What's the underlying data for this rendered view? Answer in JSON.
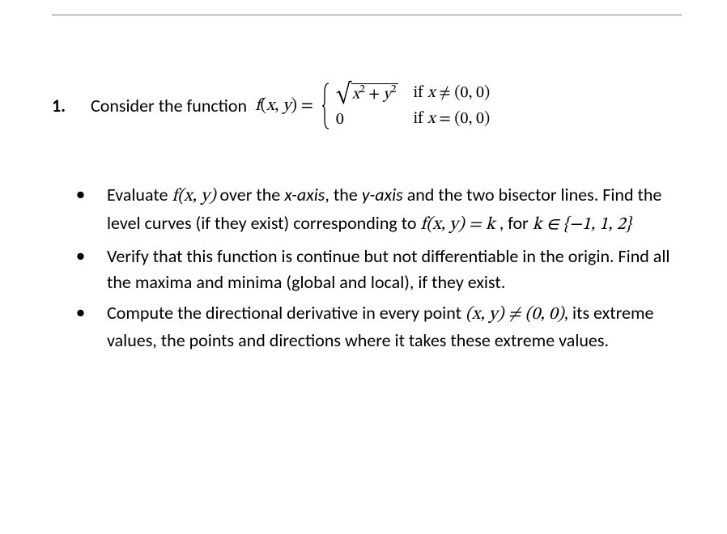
{
  "problem": {
    "number": "1.",
    "stem_text": "Consider the function",
    "func_name_html": "f(x, y) =",
    "piecewise": {
      "case1": {
        "sqrt_arg_plain": "x² + y²",
        "cond_prefix": "if ",
        "cond_math": "x ≠ (0, 0)"
      },
      "case2": {
        "value": "0",
        "cond_prefix": "if ",
        "cond_math": "x = (0, 0)"
      }
    }
  },
  "bullets": [
    {
      "parts": [
        {
          "t": "Evaluate ",
          "cls": ""
        },
        {
          "t": "f(x, y)",
          "cls": "math-serif"
        },
        {
          "t": " over the ",
          "cls": ""
        },
        {
          "t": "x-axis",
          "cls": "italic"
        },
        {
          "t": ", the ",
          "cls": ""
        },
        {
          "t": "y-axis",
          "cls": "italic"
        },
        {
          "t": " and the two bisector lines. Find the level curves (if they exist) corresponding to  ",
          "cls": ""
        },
        {
          "t": "f(x, y) = k",
          "cls": "math-serif"
        },
        {
          "t": " , for  ",
          "cls": ""
        },
        {
          "t": "k ∈ {−1, 1, 2}",
          "cls": "math-serif"
        }
      ]
    },
    {
      "parts": [
        {
          "t": "Verify that this function is continue but not differentiable in the origin. Find all the maxima and minima (global and local), if they exist.",
          "cls": ""
        }
      ]
    },
    {
      "parts": [
        {
          "t": "Compute the directional derivative in every point ",
          "cls": ""
        },
        {
          "t": "(x, y) ≠ (0, 0)",
          "cls": "math-serif"
        },
        {
          "t": ", its extreme values, the points and directions where it takes these extreme values.",
          "cls": ""
        }
      ]
    }
  ]
}
